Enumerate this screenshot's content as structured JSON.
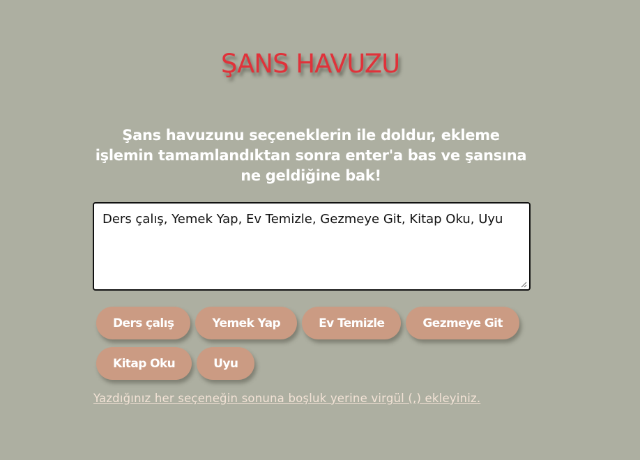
{
  "title": "ŞANS HAVUZU",
  "instructions": "Şans havuzunu seçeneklerin ile doldur, ekleme işlemin tamamlandıktan sonra enter'a bas ve şansına ne geldiğine bak!",
  "textarea": {
    "value": "Ders çalış, Yemek Yap, Ev Temizle, Gezmeye Git, Kitap Oku, Uyu"
  },
  "tags": [
    "Ders çalış",
    "Yemek Yap",
    "Ev Temizle",
    "Gezmeye Git",
    "Kitap Oku",
    "Uyu"
  ],
  "hint": "Yazdığınız her seçeneğin sonuna boşluk yerine virgül (,) ekleyiniz.",
  "colors": {
    "background": "#adafa1",
    "title": "#e0323a",
    "tag": "#cb9b83",
    "hint": "#f3e3d6"
  }
}
